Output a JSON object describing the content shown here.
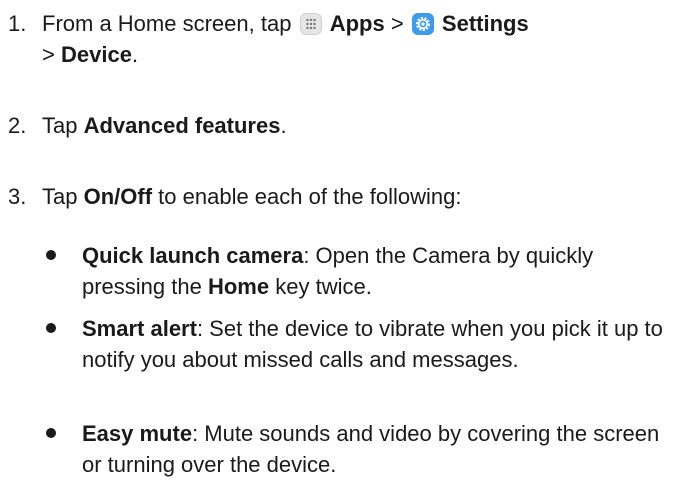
{
  "steps": [
    {
      "number": "1.",
      "before": "From a Home screen, tap",
      "apps_label": "Apps",
      "sep1": ">",
      "settings_label": "Settings",
      "sep2": ">",
      "device_label": "Device",
      "end": "."
    },
    {
      "number": "2.",
      "before": "Tap",
      "bold": "Advanced features",
      "after": "."
    },
    {
      "number": "3.",
      "before": "Tap",
      "bold": "On/Off",
      "after": "to enable each of the following:"
    }
  ],
  "bullets": [
    {
      "title": "Quick launch camera",
      "text1": ": Open the Camera by quickly pressing the",
      "bold2": "Home",
      "text2": "key twice."
    },
    {
      "title": "Smart alert",
      "text1": ": Set the device to vibrate when you pick it up to notify you about missed calls and messages."
    },
    {
      "title": "Easy mute",
      "text1": ": Mute sounds and video by covering the screen or turning over the device."
    }
  ],
  "icons": {
    "apps": "apps-grid-icon",
    "settings": "settings-gear-icon",
    "settings_color": "#3d9be9"
  }
}
